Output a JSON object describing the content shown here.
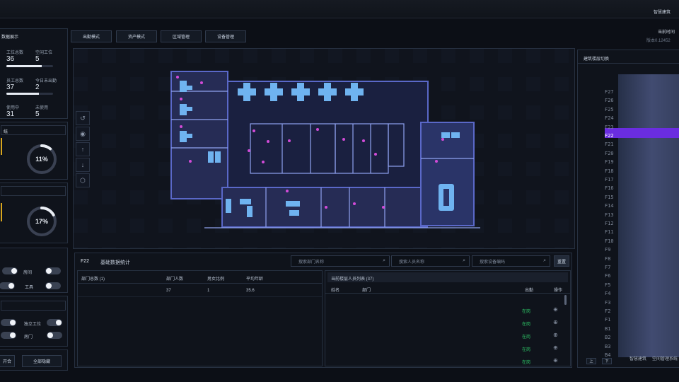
{
  "topbar": {
    "right1": "智慧建筑",
    "right2": "当前时间",
    "right3": "版本0.12452"
  },
  "left": {
    "section1_title": "数据展示",
    "stats": [
      {
        "label": "工位总数",
        "value": "36",
        "fill": 0.75
      },
      {
        "label": "空闲工位",
        "value": "5"
      },
      {
        "label": "员工总数",
        "value": "37",
        "fill": 0.7
      },
      {
        "label": "今日未出勤",
        "value": "2"
      },
      {
        "label": "使用中",
        "value": "31"
      },
      {
        "label": "未使用",
        "value": "5"
      }
    ],
    "section2_title": "统",
    "gauge1": "11%",
    "gauge1_value": 11,
    "gauge2": "17%",
    "gauge2_value": 17,
    "toggles_a": [
      "房间",
      "工具"
    ],
    "toggles_b": [
      "独立工位",
      "房门"
    ],
    "buttons": [
      "开合",
      "全部隐藏"
    ]
  },
  "modes": [
    "出勤模式",
    "资产模式",
    "区域管理",
    "设备管理"
  ],
  "floorplan": {
    "tools": [
      "↺",
      "◉",
      "↑",
      "↓",
      "⬡"
    ]
  },
  "bottom": {
    "floor": "F22",
    "title": "基础数据统计",
    "search_dept": "搜索部门名称",
    "search_person": "搜索人员名称",
    "search_device": "搜索设备编码",
    "reset": "重置",
    "dept_headers": [
      "部门总数 (1)",
      "部门人数",
      "男女比例",
      "平均年龄"
    ],
    "dept_row": [
      "",
      "37",
      "1",
      "35.6"
    ],
    "people_title": "当前楼层人员列表 (37)",
    "people_headers": [
      "姓名",
      "部门",
      "出勤",
      "操作"
    ],
    "people_rows": [
      "在岗",
      "在岗",
      "在岗",
      "在岗",
      "在岗",
      "在岗"
    ],
    "people_op": "⊕"
  },
  "right": {
    "title": "建筑楼层切换",
    "floors": [
      "F27",
      "F26",
      "F25",
      "F24",
      "F23",
      "F22",
      "F21",
      "F20",
      "F19",
      "F18",
      "F17",
      "F16",
      "F15",
      "F14",
      "F13",
      "F12",
      "F11",
      "F10",
      "F9",
      "F8",
      "F7",
      "F6",
      "F5",
      "F4",
      "F3",
      "F2",
      "F1",
      "B1",
      "B2",
      "B3",
      "B4"
    ],
    "selected": "F22",
    "footer_btns": [
      "上",
      "下"
    ],
    "footer_text1": "智慧建筑",
    "footer_text2": "空间管理系统"
  }
}
